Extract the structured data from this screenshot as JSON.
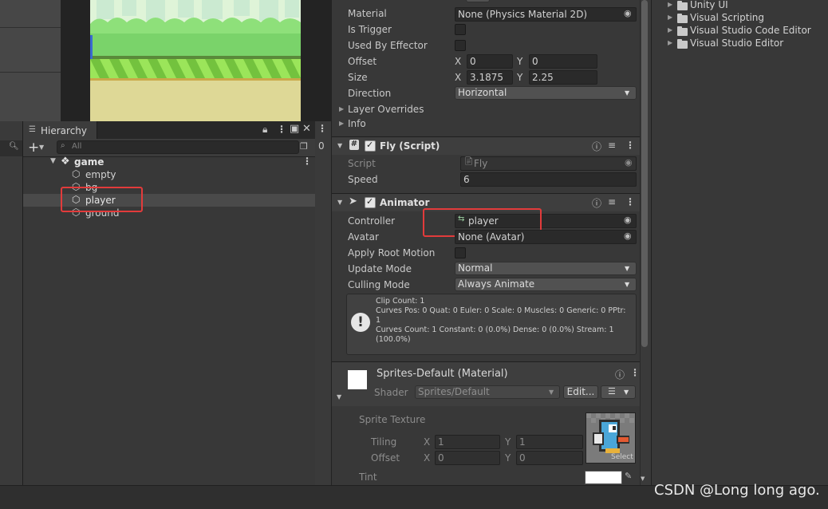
{
  "hierarchy": {
    "tab_label": "Hierarchy",
    "search_placeholder": "All",
    "scene_name": "game",
    "items": [
      {
        "label": "empty"
      },
      {
        "label": "bg"
      },
      {
        "label": "player"
      },
      {
        "label": "ground"
      }
    ],
    "side_value": "0"
  },
  "inspector": {
    "collider": {
      "material_label": "Material",
      "material_value": "None (Physics Material 2D)",
      "is_trigger_label": "Is Trigger",
      "used_by_effector_label": "Used By Effector",
      "offset_label": "Offset",
      "offset_x": "0",
      "offset_y": "0",
      "size_label": "Size",
      "size_x": "3.1875",
      "size_y": "2.25",
      "direction_label": "Direction",
      "direction_value": "Horizontal",
      "layer_overrides_label": "Layer Overrides",
      "info_label": "Info",
      "x_label": "X",
      "y_label": "Y"
    },
    "fly_script": {
      "title": "Fly (Script)",
      "script_label": "Script",
      "script_value": "Fly",
      "speed_label": "Speed",
      "speed_value": "6"
    },
    "animator": {
      "title": "Animator",
      "controller_label": "Controller",
      "controller_value": "player",
      "avatar_label": "Avatar",
      "avatar_value": "None (Avatar)",
      "apply_root_motion_label": "Apply Root Motion",
      "update_mode_label": "Update Mode",
      "update_mode_value": "Normal",
      "culling_mode_label": "Culling Mode",
      "culling_mode_value": "Always Animate",
      "info_line1": "Clip Count: 1",
      "info_line2": "Curves Pos: 0 Quat: 0 Euler: 0 Scale: 0 Muscles: 0 Generic: 0 PPtr: 1",
      "info_line3": "Curves Count: 1 Constant: 0 (0.0%) Dense: 0 (0.0%) Stream: 1 (100.0%)"
    },
    "material": {
      "title": "Sprites-Default (Material)",
      "shader_label": "Shader",
      "shader_value": "Sprites/Default",
      "edit_label": "Edit...",
      "sprite_texture_label": "Sprite Texture",
      "tiling_label": "Tiling",
      "tiling_x": "1",
      "tiling_y": "1",
      "offset_label": "Offset",
      "offset_x": "0",
      "offset_y": "0",
      "select_label": "Select",
      "tint_label": "Tint",
      "x_label": "X",
      "y_label": "Y"
    }
  },
  "project": {
    "folders": [
      {
        "label": "Unity UI"
      },
      {
        "label": "Visual Scripting"
      },
      {
        "label": "Visual Studio Code Editor"
      },
      {
        "label": "Visual Studio Editor"
      }
    ]
  },
  "watermark": "CSDN @Long long ago.",
  "colors": {
    "highlight_red": "#e23b3b",
    "selected_row": "#4a4a4a",
    "panel_bg": "#383838"
  }
}
